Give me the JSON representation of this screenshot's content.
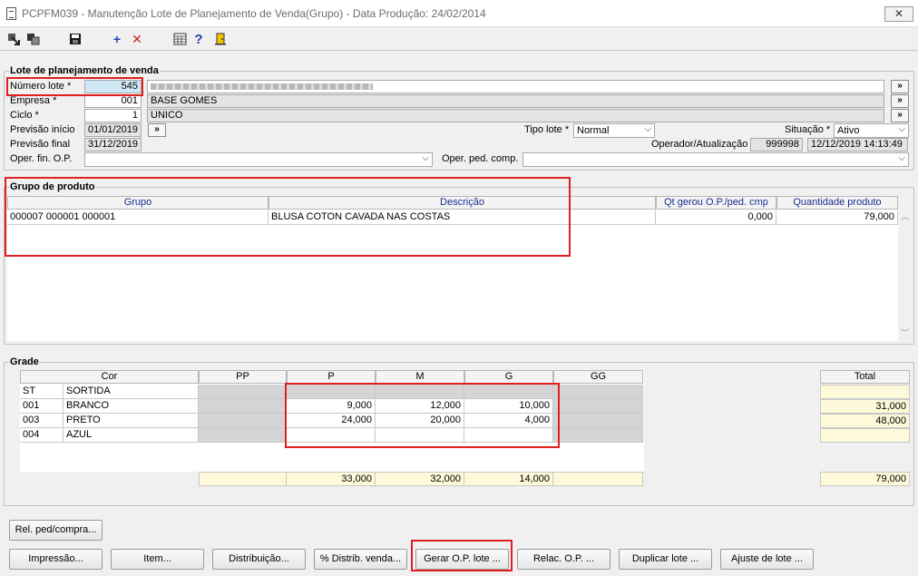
{
  "window": {
    "title": "PCPFM039 - Manutenção Lote de Planejamento de Venda(Grupo) - Data Produção: 24/02/2014",
    "close_glyph": "✕"
  },
  "toolbar": {
    "items": [
      "exit-icon",
      "copy-icon",
      "save-icon",
      "add-icon",
      "delete-icon",
      "calculator-icon",
      "help-icon",
      "door-icon"
    ]
  },
  "lote": {
    "section_label": "Lote de planejamento de venda",
    "numero_label": "Número lote *",
    "numero_value": "545",
    "empresa_label": "Empresa *",
    "empresa_code": "001",
    "empresa_name": "BASE GOMES",
    "ciclo_label": "Ciclo *",
    "ciclo_code": "1",
    "ciclo_name": "UNICO",
    "previsao_inicio_label": "Previsão início",
    "previsao_inicio_value": "01/01/2019",
    "previsao_final_label": "Previsão final",
    "previsao_final_value": "31/12/2019",
    "oper_fin_label": "Oper. fin. O.P.",
    "oper_ped_label": "Oper. ped. comp.",
    "tipo_lote_label": "Tipo lote *",
    "tipo_lote_value": "Normal",
    "situacao_label": "Situação *",
    "situacao_value": "Ativo",
    "operador_label": "Operador/Atualização",
    "operador_value": "999998",
    "atualizacao_value": "12/12/2019 14:13:49",
    "search_glyph": "»"
  },
  "grupo": {
    "section_label": "Grupo de produto",
    "headers": {
      "grupo": "Grupo",
      "descricao": "Descrição",
      "qt_gerou": "Qt gerou O.P./ped. cmp",
      "quantidade": "Quantidade produto"
    },
    "rows": [
      {
        "grupo": "000007 000001 000001",
        "descricao": "BLUSA COTON CAVADA NAS COSTAS",
        "qt_gerou": "0,000",
        "quantidade": "79,000"
      }
    ]
  },
  "grade": {
    "section_label": "Grade",
    "headers": {
      "cor": "Cor",
      "pp": "PP",
      "p": "P",
      "m": "M",
      "g": "G",
      "gg": "GG",
      "total": "Total"
    },
    "rows": [
      {
        "code": "ST",
        "name": "SORTIDA",
        "pp": "",
        "p": "",
        "m": "",
        "g": "",
        "gg": "",
        "total": ""
      },
      {
        "code": "001",
        "name": "BRANCO",
        "pp": "",
        "p": "9,000",
        "m": "12,000",
        "g": "10,000",
        "gg": "",
        "total": "31,000"
      },
      {
        "code": "003",
        "name": "PRETO",
        "pp": "",
        "p": "24,000",
        "m": "20,000",
        "g": "4,000",
        "gg": "",
        "total": "48,000"
      },
      {
        "code": "004",
        "name": "AZUL",
        "pp": "",
        "p": "",
        "m": "",
        "g": "",
        "gg": "",
        "total": ""
      }
    ],
    "totals": {
      "pp": "",
      "p": "33,000",
      "m": "32,000",
      "g": "14,000",
      "gg": "",
      "total": "79,000"
    }
  },
  "buttons": {
    "rel_ped": "Rel. ped/compra...",
    "impressao": "Impressão...",
    "item": "Item...",
    "distribuicao": "Distribuição...",
    "distrib_venda": "% Distrib. venda...",
    "gerar_op": "Gerar O.P. lote ...",
    "relac_op": "Relac. O.P. ...",
    "duplicar": "Duplicar lote ...",
    "ajuste": "Ajuste de lote ..."
  },
  "colors": {
    "highlight_red": "#e02020",
    "header_blue": "#1a2d8e",
    "yellow_cell": "#fdf9d9",
    "gray_cell": "#d4d4d4"
  }
}
